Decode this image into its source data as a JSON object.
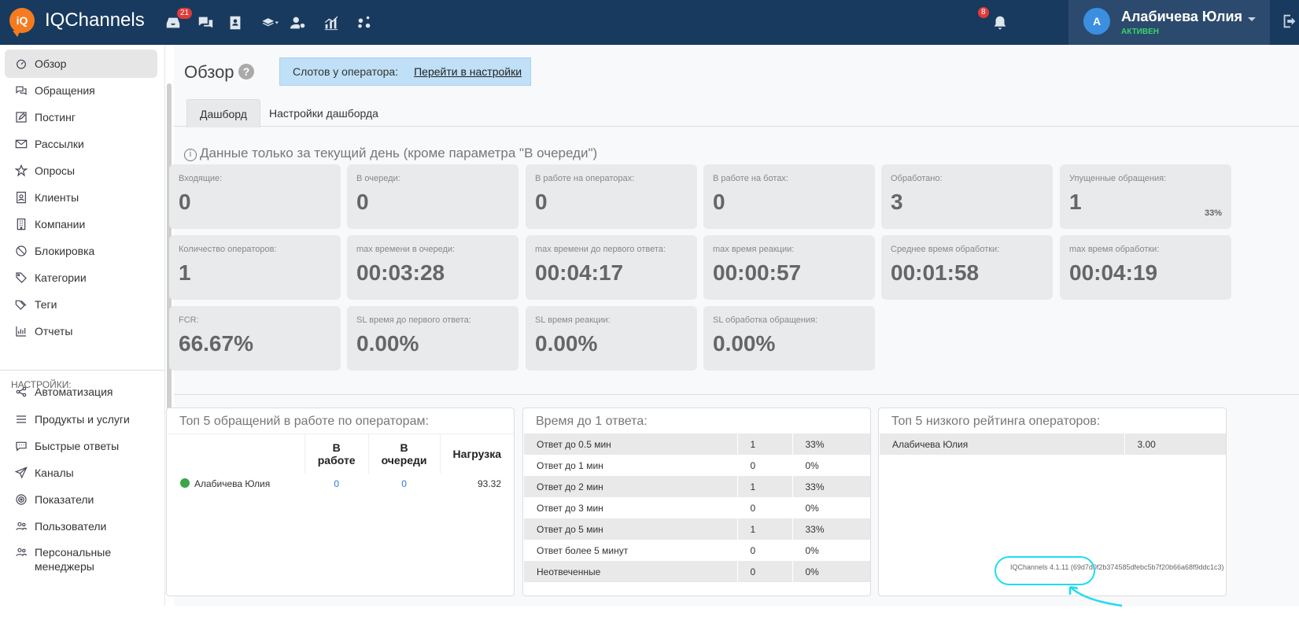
{
  "app": {
    "brand": "IQChannels",
    "logo_text": "iQ"
  },
  "topbar": {
    "inbox_badge": "21",
    "notif_badge": "8",
    "user_initial": "А",
    "user_name": "Алабичева Юлия",
    "user_status": "АКТИВЕН"
  },
  "sidebar": {
    "items": [
      {
        "label": "Обзор",
        "icon": "dashboard-icon"
      },
      {
        "label": "Обращения",
        "icon": "chat-icon"
      },
      {
        "label": "Постинг",
        "icon": "edit-icon"
      },
      {
        "label": "Рассылки",
        "icon": "mail-icon"
      },
      {
        "label": "Опросы",
        "icon": "star-icon"
      },
      {
        "label": "Клиенты",
        "icon": "contact-icon"
      },
      {
        "label": "Компании",
        "icon": "building-icon"
      },
      {
        "label": "Блокировка",
        "icon": "ban-icon"
      },
      {
        "label": "Категории",
        "icon": "tag-icon"
      },
      {
        "label": "Теги",
        "icon": "tags-icon"
      },
      {
        "label": "Отчеты",
        "icon": "chart-icon"
      }
    ],
    "section_label": "НАСТРОЙКИ:",
    "settings_items": [
      {
        "label": "Автоматизация",
        "icon": "share-icon"
      },
      {
        "label": "Продукты и услуги",
        "icon": "list-icon"
      },
      {
        "label": "Быстрые ответы",
        "icon": "comment-icon"
      },
      {
        "label": "Каналы",
        "icon": "send-icon"
      },
      {
        "label": "Показатели",
        "icon": "target-icon"
      },
      {
        "label": "Пользователи",
        "icon": "users-icon"
      },
      {
        "label": "Персональные",
        "label2": "менеджеры",
        "icon": "users-icon"
      }
    ]
  },
  "main": {
    "title": "Обзор",
    "help": "?",
    "slot_label": "Слотов у оператора:",
    "slot_link": "Перейти в настройки",
    "tabs": [
      "Дашборд",
      "Настройки дашборда"
    ],
    "info": "Данные только за текущий день (кроме параметра \"В очереди\")",
    "info_icon": "i",
    "cards": [
      {
        "label": "Входящие:",
        "value": "0"
      },
      {
        "label": "В очереди:",
        "value": "0"
      },
      {
        "label": "В работе на операторах:",
        "value": "0"
      },
      {
        "label": "В работе на ботах:",
        "value": "0"
      },
      {
        "label": "Обработано:",
        "value": "3"
      },
      {
        "label": "Упущенные обращения:",
        "value": "1",
        "pct": "33%"
      },
      {
        "label": "Количество операторов:",
        "value": "1"
      },
      {
        "label": "max времени в очереди:",
        "value": "00:03:28"
      },
      {
        "label": "max времени до первого ответа:",
        "value": "00:04:17"
      },
      {
        "label": "max время реакции:",
        "value": "00:00:57"
      },
      {
        "label": "Среднее время обработки:",
        "value": "00:01:58"
      },
      {
        "label": "max время обработки:",
        "value": "00:04:19"
      },
      {
        "label": "FCR:",
        "value": "66.67%"
      },
      {
        "label": "SL время до первого ответа:",
        "value": "0.00%"
      },
      {
        "label": "SL время реакции:",
        "value": "0.00%"
      },
      {
        "label": "SL обработка обращения:",
        "value": "0.00%"
      }
    ],
    "panel_ops": {
      "title": "Топ 5 обращений в работе по операторам:",
      "headers": [
        "",
        "В работе",
        "В очереди",
        "Нагрузка"
      ],
      "rows": [
        [
          "Алабичева Юлия",
          "0",
          "0",
          "93.32"
        ]
      ]
    },
    "panel_resp": {
      "title": "Время до 1 ответа:",
      "rows": [
        [
          "Ответ до 0.5 мин",
          "1",
          "33%"
        ],
        [
          "Ответ до 1 мин",
          "0",
          "0%"
        ],
        [
          "Ответ до 2 мин",
          "1",
          "33%"
        ],
        [
          "Ответ до 3 мин",
          "0",
          "0%"
        ],
        [
          "Ответ до 5 мин",
          "1",
          "33%"
        ],
        [
          "Ответ более 5 минут",
          "0",
          "0%"
        ],
        [
          "Неотвеченные",
          "0",
          "0%"
        ]
      ]
    },
    "panel_rating": {
      "title": "Топ 5 низкого рейтинга операторов:",
      "rows": [
        [
          "Алабичева Юлия",
          "3.00"
        ]
      ]
    }
  },
  "footer": {
    "version": "IQChannels 4.1.11 (69d7d0f2b374585dfebc5b7f20b66a68f9ddc1c3)"
  }
}
